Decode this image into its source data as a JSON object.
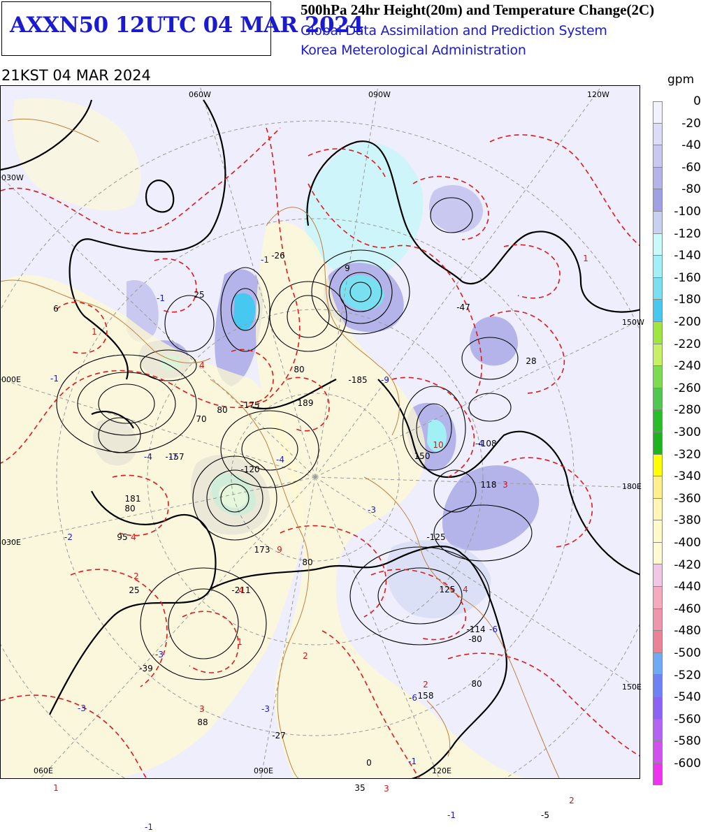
{
  "header": {
    "map_id": "AXXN50 12UTC 04 MAR 2024",
    "title": "500hPa 24hr Height(20m) and Temperature Change(2C)",
    "system": "Global Data Assimilation and Prediction System",
    "agency": "Korea Meterological Administration",
    "valid_time": "21KST 04 MAR 2024"
  },
  "legend": {
    "unit": "gpm",
    "labels": [
      "0",
      "-20",
      "-40",
      "-60",
      "-80",
      "-100",
      "-120",
      "-140",
      "-160",
      "-180",
      "-200",
      "-220",
      "-240",
      "-260",
      "-280",
      "-300",
      "-320",
      "-340",
      "-360",
      "-380",
      "-400",
      "-420",
      "-440",
      "-460",
      "-480",
      "-500",
      "-520",
      "-540",
      "-560",
      "-580",
      "-600"
    ],
    "colors": [
      "#f2f2fe",
      "#dcdcf6",
      "#c8c8f0",
      "#b4b4ea",
      "#a0a0e4",
      "#c8d2f0",
      "#c8fafa",
      "#a0f0f6",
      "#78e0f0",
      "#46c8f0",
      "#a0e640",
      "#c8f064",
      "#7cdc50",
      "#50c850",
      "#28be28",
      "#1eb41e",
      "#ffff00",
      "#fff08c",
      "#fff5b4",
      "#fffac8",
      "#fffad2",
      "#f0c8e6",
      "#f5aabe",
      "#f096aa",
      "#eb8296",
      "#6eaaf5",
      "#6e82f5",
      "#8c64f5",
      "#b464f5",
      "#d250f0",
      "#f032f0"
    ]
  },
  "map": {
    "longitude_labels": [
      "060W",
      "090W",
      "120W",
      "030W",
      "150W",
      "000E",
      "180E",
      "030E",
      "150E",
      "060E",
      "090E",
      "120E"
    ],
    "height_change_labels": [
      {
        "text": "6",
        "color": "black"
      },
      {
        "text": "-26",
        "color": "black"
      },
      {
        "text": "9",
        "color": "black"
      },
      {
        "text": "25",
        "color": "black"
      },
      {
        "text": "-47",
        "color": "black"
      },
      {
        "text": "28",
        "color": "black"
      },
      {
        "text": "-185",
        "color": "black"
      },
      {
        "text": "-175",
        "color": "black"
      },
      {
        "text": "189",
        "color": "black"
      },
      {
        "text": "70",
        "color": "black"
      },
      {
        "text": "80",
        "color": "black"
      },
      {
        "text": "80",
        "color": "black"
      },
      {
        "text": "-108",
        "color": "black"
      },
      {
        "text": "-157",
        "color": "black"
      },
      {
        "text": "150",
        "color": "black"
      },
      {
        "text": "-120",
        "color": "black"
      },
      {
        "text": "181",
        "color": "black"
      },
      {
        "text": "118",
        "color": "black"
      },
      {
        "text": "80",
        "color": "black"
      },
      {
        "text": "-125",
        "color": "black"
      },
      {
        "text": "95",
        "color": "black"
      },
      {
        "text": "173",
        "color": "black"
      },
      {
        "text": "80",
        "color": "black"
      },
      {
        "text": "-211",
        "color": "black"
      },
      {
        "text": "125",
        "color": "black"
      },
      {
        "text": "25",
        "color": "black"
      },
      {
        "text": "-114",
        "color": "black"
      },
      {
        "text": "-80",
        "color": "black"
      },
      {
        "text": "-39",
        "color": "black"
      },
      {
        "text": "158",
        "color": "black"
      },
      {
        "text": "80",
        "color": "black"
      },
      {
        "text": "88",
        "color": "black"
      },
      {
        "text": "-27",
        "color": "black"
      },
      {
        "text": "35",
        "color": "black"
      },
      {
        "text": "-5",
        "color": "black"
      },
      {
        "text": "0",
        "color": "black"
      }
    ],
    "temperature_change_labels": [
      {
        "text": "-1",
        "color": "blue"
      },
      {
        "text": "1",
        "color": "red"
      },
      {
        "text": "-1",
        "color": "blue"
      },
      {
        "text": "4",
        "color": "red"
      },
      {
        "text": "-1",
        "color": "blue"
      },
      {
        "text": "1",
        "color": "red"
      },
      {
        "text": "-4",
        "color": "blue"
      },
      {
        "text": "-3",
        "color": "blue"
      },
      {
        "text": "-9",
        "color": "blue"
      },
      {
        "text": "-4",
        "color": "blue"
      },
      {
        "text": "10",
        "color": "red"
      },
      {
        "text": "3",
        "color": "red"
      },
      {
        "text": "-7",
        "color": "blue"
      },
      {
        "text": "-3",
        "color": "blue"
      },
      {
        "text": "-4",
        "color": "blue"
      },
      {
        "text": "-2",
        "color": "blue"
      },
      {
        "text": "9",
        "color": "red"
      },
      {
        "text": "2",
        "color": "red"
      },
      {
        "text": "4",
        "color": "red"
      },
      {
        "text": "-6",
        "color": "blue"
      },
      {
        "text": "-3",
        "color": "blue"
      },
      {
        "text": "1",
        "color": "red"
      },
      {
        "text": "2",
        "color": "red"
      },
      {
        "text": "-3",
        "color": "blue"
      },
      {
        "text": "3",
        "color": "red"
      },
      {
        "text": "-6",
        "color": "blue"
      },
      {
        "text": "3",
        "color": "red"
      },
      {
        "text": "-1",
        "color": "blue"
      },
      {
        "text": "1",
        "color": "red"
      },
      {
        "text": "-1",
        "color": "blue"
      },
      {
        "text": "-1",
        "color": "blue"
      },
      {
        "text": "2",
        "color": "red"
      },
      {
        "text": "4",
        "color": "red"
      },
      {
        "text": "2",
        "color": "red"
      },
      {
        "text": "4",
        "color": "red"
      }
    ]
  }
}
